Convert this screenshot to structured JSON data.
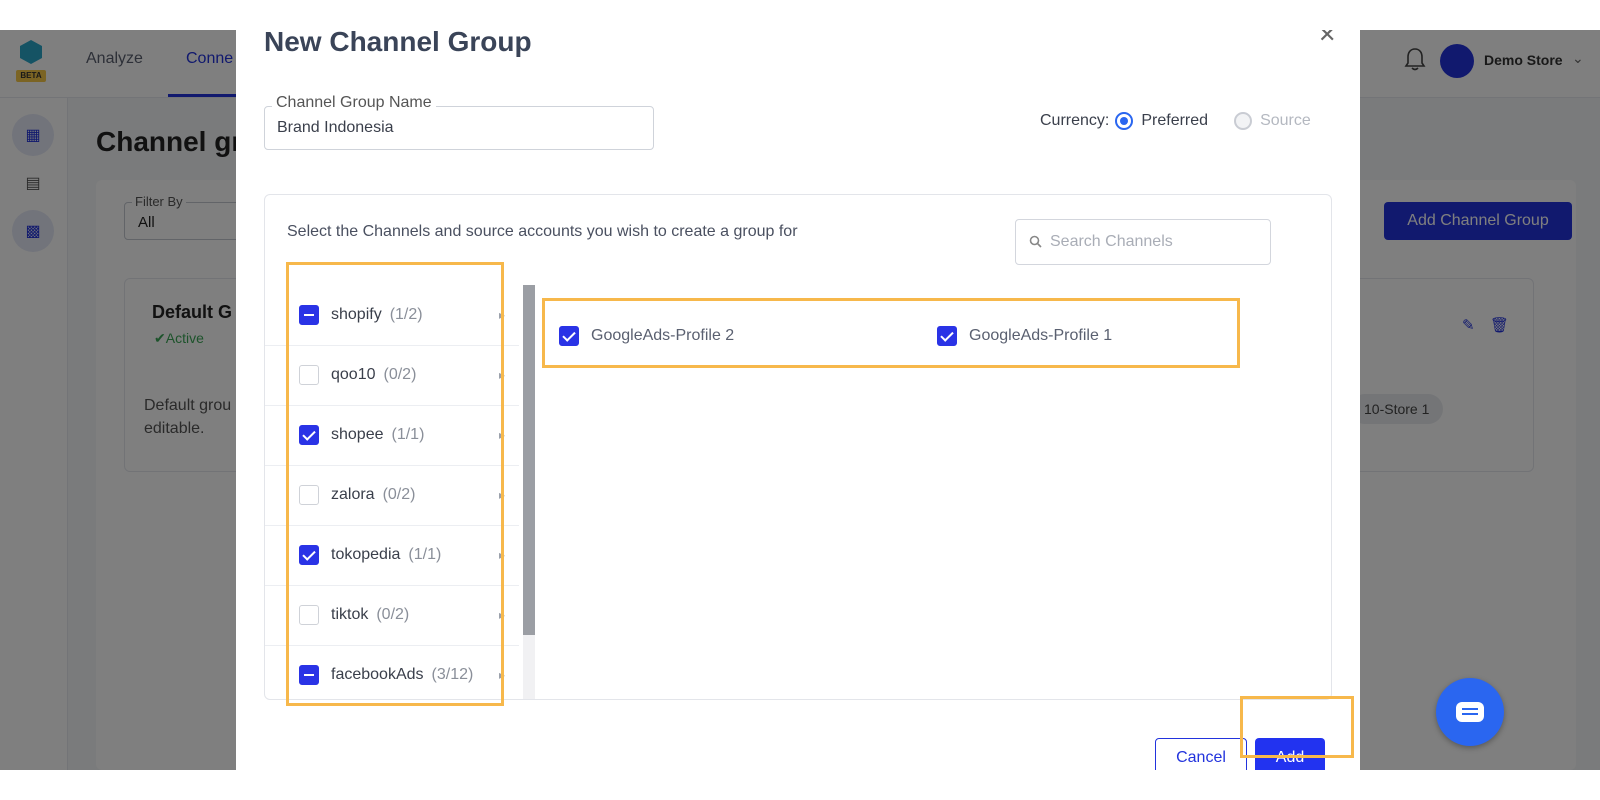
{
  "background": {
    "nav": {
      "analyze": "Analyze",
      "connect": "Conne"
    },
    "store_name": "Demo Store",
    "logo_badge": "BETA",
    "page_title": "Channel gr",
    "filter_label": "Filter By",
    "filter_value": "All",
    "add_group_button": "Add Channel Group",
    "default_group_title": "Default G",
    "status": "Active",
    "description": "Default grou editable.",
    "chip": "10-Store 1"
  },
  "modal": {
    "title": "New Channel Group",
    "name_label": "Channel Group Name",
    "name_value": "Brand Indonesia",
    "currency_label": "Currency:",
    "currency_options": [
      "Preferred",
      "Source"
    ],
    "instruction": "Select the Channels and source accounts you wish to create a group for",
    "search_placeholder": "Search Channels",
    "channels": [
      {
        "name": "shopify",
        "count": "(1/2)",
        "state": "partial"
      },
      {
        "name": "qoo10",
        "count": "(0/2)",
        "state": "unchecked"
      },
      {
        "name": "shopee",
        "count": "(1/1)",
        "state": "checked"
      },
      {
        "name": "zalora",
        "count": "(0/2)",
        "state": "unchecked"
      },
      {
        "name": "tokopedia",
        "count": "(1/1)",
        "state": "checked"
      },
      {
        "name": "tiktok",
        "count": "(0/2)",
        "state": "unchecked"
      },
      {
        "name": "facebookAds",
        "count": "(3/12)",
        "state": "partial"
      }
    ],
    "accounts": [
      {
        "label": "GoogleAds-Profile 2",
        "checked": true
      },
      {
        "label": "GoogleAds-Profile 1",
        "checked": true
      }
    ],
    "cancel_label": "Cancel",
    "add_label": "Add"
  },
  "colors": {
    "accent": "#2233dd",
    "highlight": "#f7b84b"
  }
}
